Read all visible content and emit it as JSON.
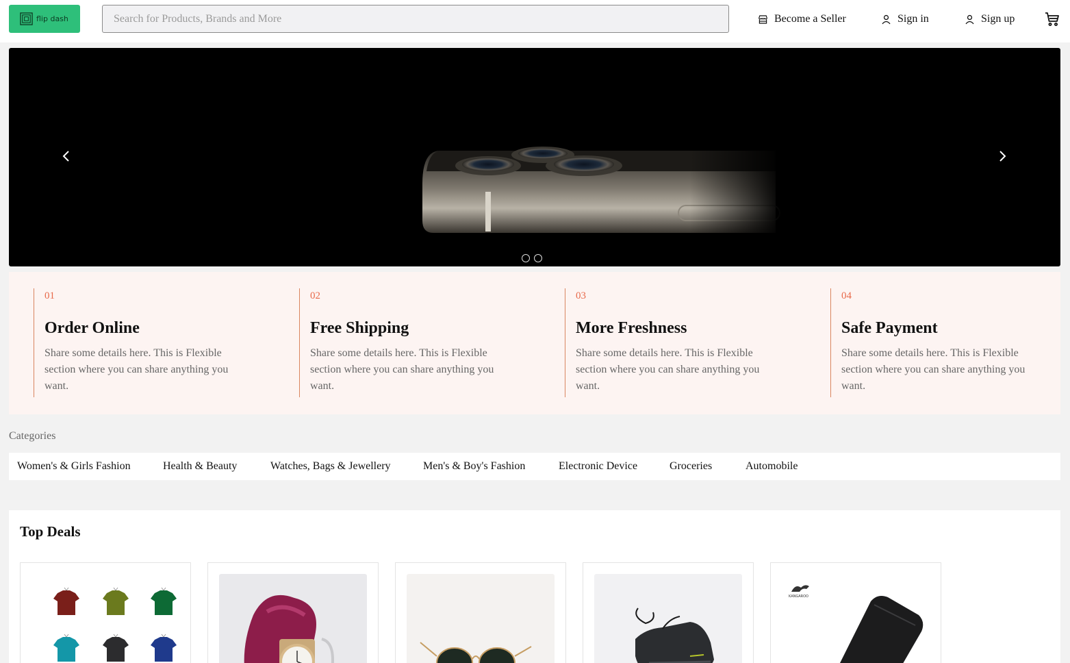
{
  "header": {
    "logo_text": "flip dash",
    "search_placeholder": "Search for Products, Brands and More",
    "become_seller": "Become a Seller",
    "sign_in": "Sign in",
    "sign_up": "Sign up",
    "brand_color": "#2ebf7a"
  },
  "hero": {
    "slide_count": 2
  },
  "features": [
    {
      "num": "01",
      "title": "Order Online",
      "desc": "Share some details here. This is Flexible section where you can share anything you want."
    },
    {
      "num": "02",
      "title": "Free Shipping",
      "desc": "Share some details here. This is Flexible section where you can share anything you want."
    },
    {
      "num": "03",
      "title": "More Freshness",
      "desc": "Share some details here. This is Flexible section where you can share anything you want."
    },
    {
      "num": "04",
      "title": "Safe Payment",
      "desc": "Share some details here. This is Flexible section where you can share anything you want."
    }
  ],
  "categories": {
    "label": "Categories",
    "items": [
      "Women's & Girls Fashion",
      "Health & Beauty",
      "Watches, Bags & Jewellery",
      "Men's & Boy's Fashion",
      "Electronic Device",
      "Groceries",
      "Automobile"
    ]
  },
  "deals": {
    "title": "Top Deals",
    "items": [
      {
        "image": "tshirts-grid"
      },
      {
        "image": "watch-with-scarf"
      },
      {
        "image": "sunglasses"
      },
      {
        "image": "sneaker"
      },
      {
        "image": "leather-wallet"
      }
    ],
    "wallet_brand_text": "KANGAROO"
  },
  "colors": {
    "accent_orange": "#e8694a",
    "feature_bg": "#fdf4f2"
  }
}
